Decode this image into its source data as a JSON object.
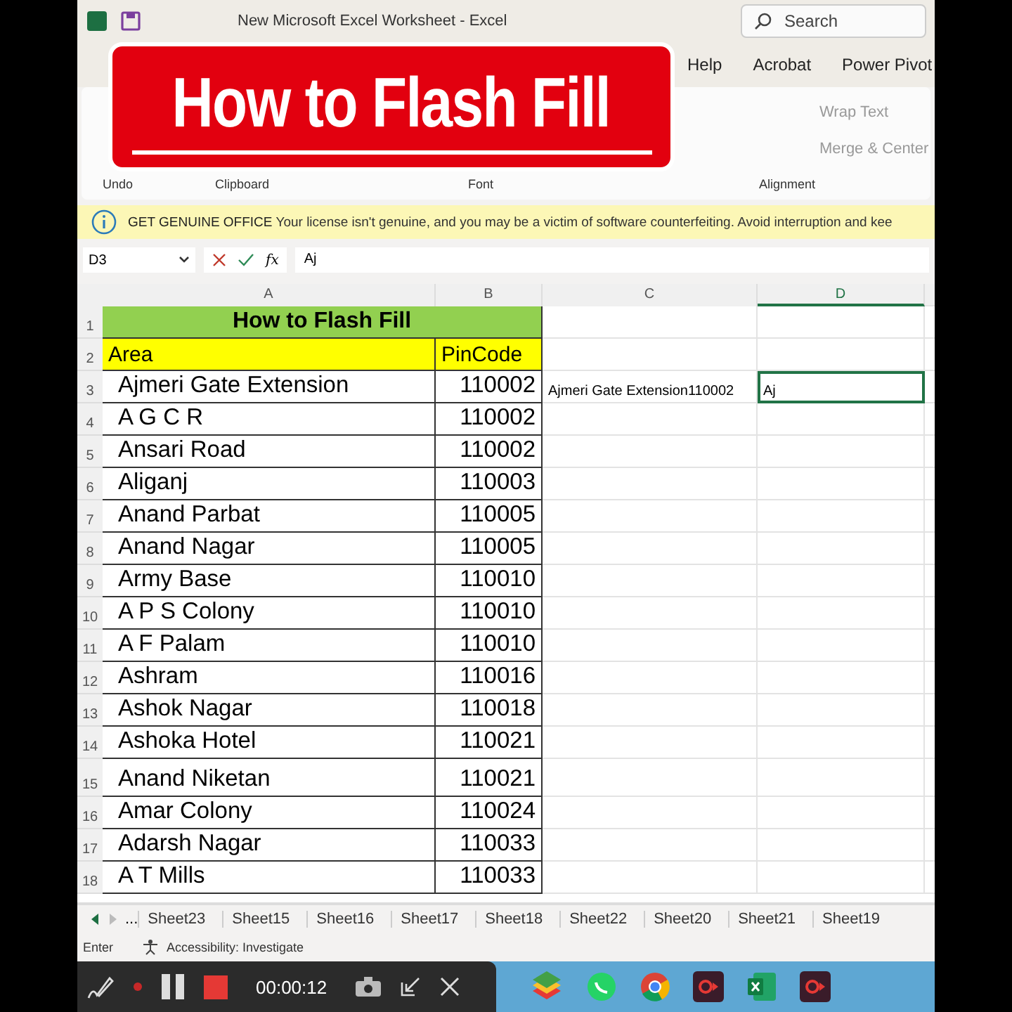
{
  "window": {
    "title": "New Microsoft Excel Worksheet - Excel"
  },
  "search": {
    "placeholder": "Search"
  },
  "overlay_banner": {
    "title": "How to Flash Fill"
  },
  "menu_tabs": [
    "Help",
    "Acrobat",
    "Power Pivot"
  ],
  "ribbon": {
    "buttons": [
      "Wrap Text",
      "Merge & Center"
    ],
    "groups": [
      "Undo",
      "Clipboard",
      "Font",
      "Alignment"
    ]
  },
  "info_bar": {
    "heading": "GET GENUINE OFFICE",
    "message": "Your license isn't genuine, and you may be a victim of software counterfeiting. Avoid interruption and kee"
  },
  "formula_bar": {
    "name_box": "D3",
    "function_button": "fx",
    "value": "Aj"
  },
  "sheet": {
    "columns": [
      "A",
      "B",
      "C",
      "D"
    ],
    "title_row": "1",
    "title": "How to Flash Fill",
    "header_row": "2",
    "headers": [
      "Area",
      "PinCode"
    ],
    "rows": [
      {
        "number": "3",
        "area": "Ajmeri Gate Extension",
        "pin": "110002",
        "column_c": "Ajmeri Gate Extension110002",
        "column_d": "Aj",
        "selected": true
      },
      {
        "number": "4",
        "area": "A G C R",
        "pin": "110002",
        "selected": false
      },
      {
        "number": "5",
        "area": "Ansari Road",
        "pin": "110002",
        "selected": false
      },
      {
        "number": "6",
        "area": "Aliganj",
        "pin": "110003",
        "selected": false
      },
      {
        "number": "7",
        "area": "Anand Parbat",
        "pin": "110005",
        "selected": false
      },
      {
        "number": "8",
        "area": "Anand Nagar",
        "pin": "110005",
        "selected": false
      },
      {
        "number": "9",
        "area": "Army Base",
        "pin": "110010",
        "selected": false
      },
      {
        "number": "10",
        "area": "A P S Colony",
        "pin": "110010",
        "selected": false
      },
      {
        "number": "11",
        "area": "A F Palam",
        "pin": "110010",
        "selected": false
      },
      {
        "number": "12",
        "area": "Ashram",
        "pin": "110016",
        "selected": false
      },
      {
        "number": "13",
        "area": "Ashok Nagar",
        "pin": "110018",
        "selected": false
      },
      {
        "number": "14",
        "area": "Ashoka Hotel",
        "pin": "110021",
        "selected": false
      },
      {
        "number": "15",
        "area": "Anand Niketan",
        "pin": "110021",
        "selected": false
      },
      {
        "number": "16",
        "area": "Amar Colony",
        "pin": "110024",
        "selected": false
      },
      {
        "number": "17",
        "area": "Adarsh Nagar",
        "pin": "110033",
        "selected": false
      },
      {
        "number": "18",
        "area": "A T Mills",
        "pin": "110033",
        "selected": false
      }
    ]
  },
  "sheet_tabs": {
    "more": "...",
    "tabs": [
      "Sheet23",
      "Sheet15",
      "Sheet16",
      "Sheet17",
      "Sheet18",
      "Sheet22",
      "Sheet20",
      "Sheet21",
      "Sheet19"
    ]
  },
  "status_bar": {
    "mode": "Enter",
    "accessibility": "Accessibility: Investigate"
  },
  "recorder": {
    "time": "00:00:12"
  }
}
